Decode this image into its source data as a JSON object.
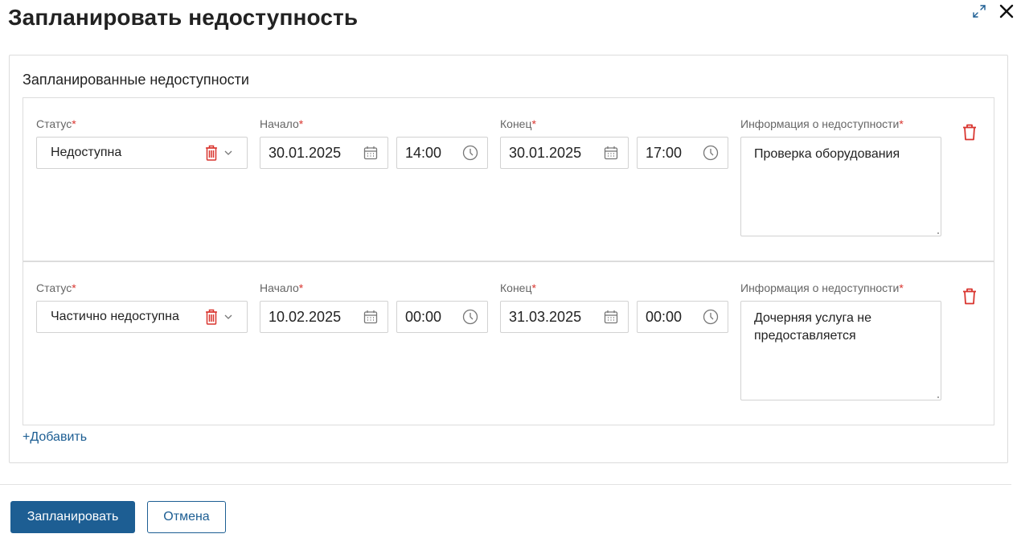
{
  "dialog": {
    "title": "Запланировать недоступность"
  },
  "section": {
    "title": "Запланированные недоступности"
  },
  "labels": {
    "status": "Статус",
    "start": "Начало",
    "end": "Конец",
    "info": "Информация о недоступности",
    "required_mark": "*"
  },
  "rows": [
    {
      "status": "Недоступна",
      "start_date": "30.01.2025",
      "start_time": "14:00",
      "end_date": "30.01.2025",
      "end_time": "17:00",
      "info": "Проверка оборудования"
    },
    {
      "status": "Частично недоступна",
      "start_date": "10.02.2025",
      "start_time": "00:00",
      "end_date": "31.03.2025",
      "end_time": "00:00",
      "info": "Дочерняя услуга не предоставляется"
    }
  ],
  "add_link": "+Добавить",
  "footer": {
    "submit_label": "Запланировать",
    "cancel_label": "Отмена"
  },
  "icons": {
    "expand": "expand-icon",
    "close": "close-icon",
    "trash": "trash-icon",
    "chevron": "chevron-down-icon",
    "calendar": "calendar-icon",
    "clock": "clock-icon"
  },
  "colors": {
    "primary": "#1d5e93",
    "danger": "#d9352f",
    "border": "#d2d2d2"
  }
}
